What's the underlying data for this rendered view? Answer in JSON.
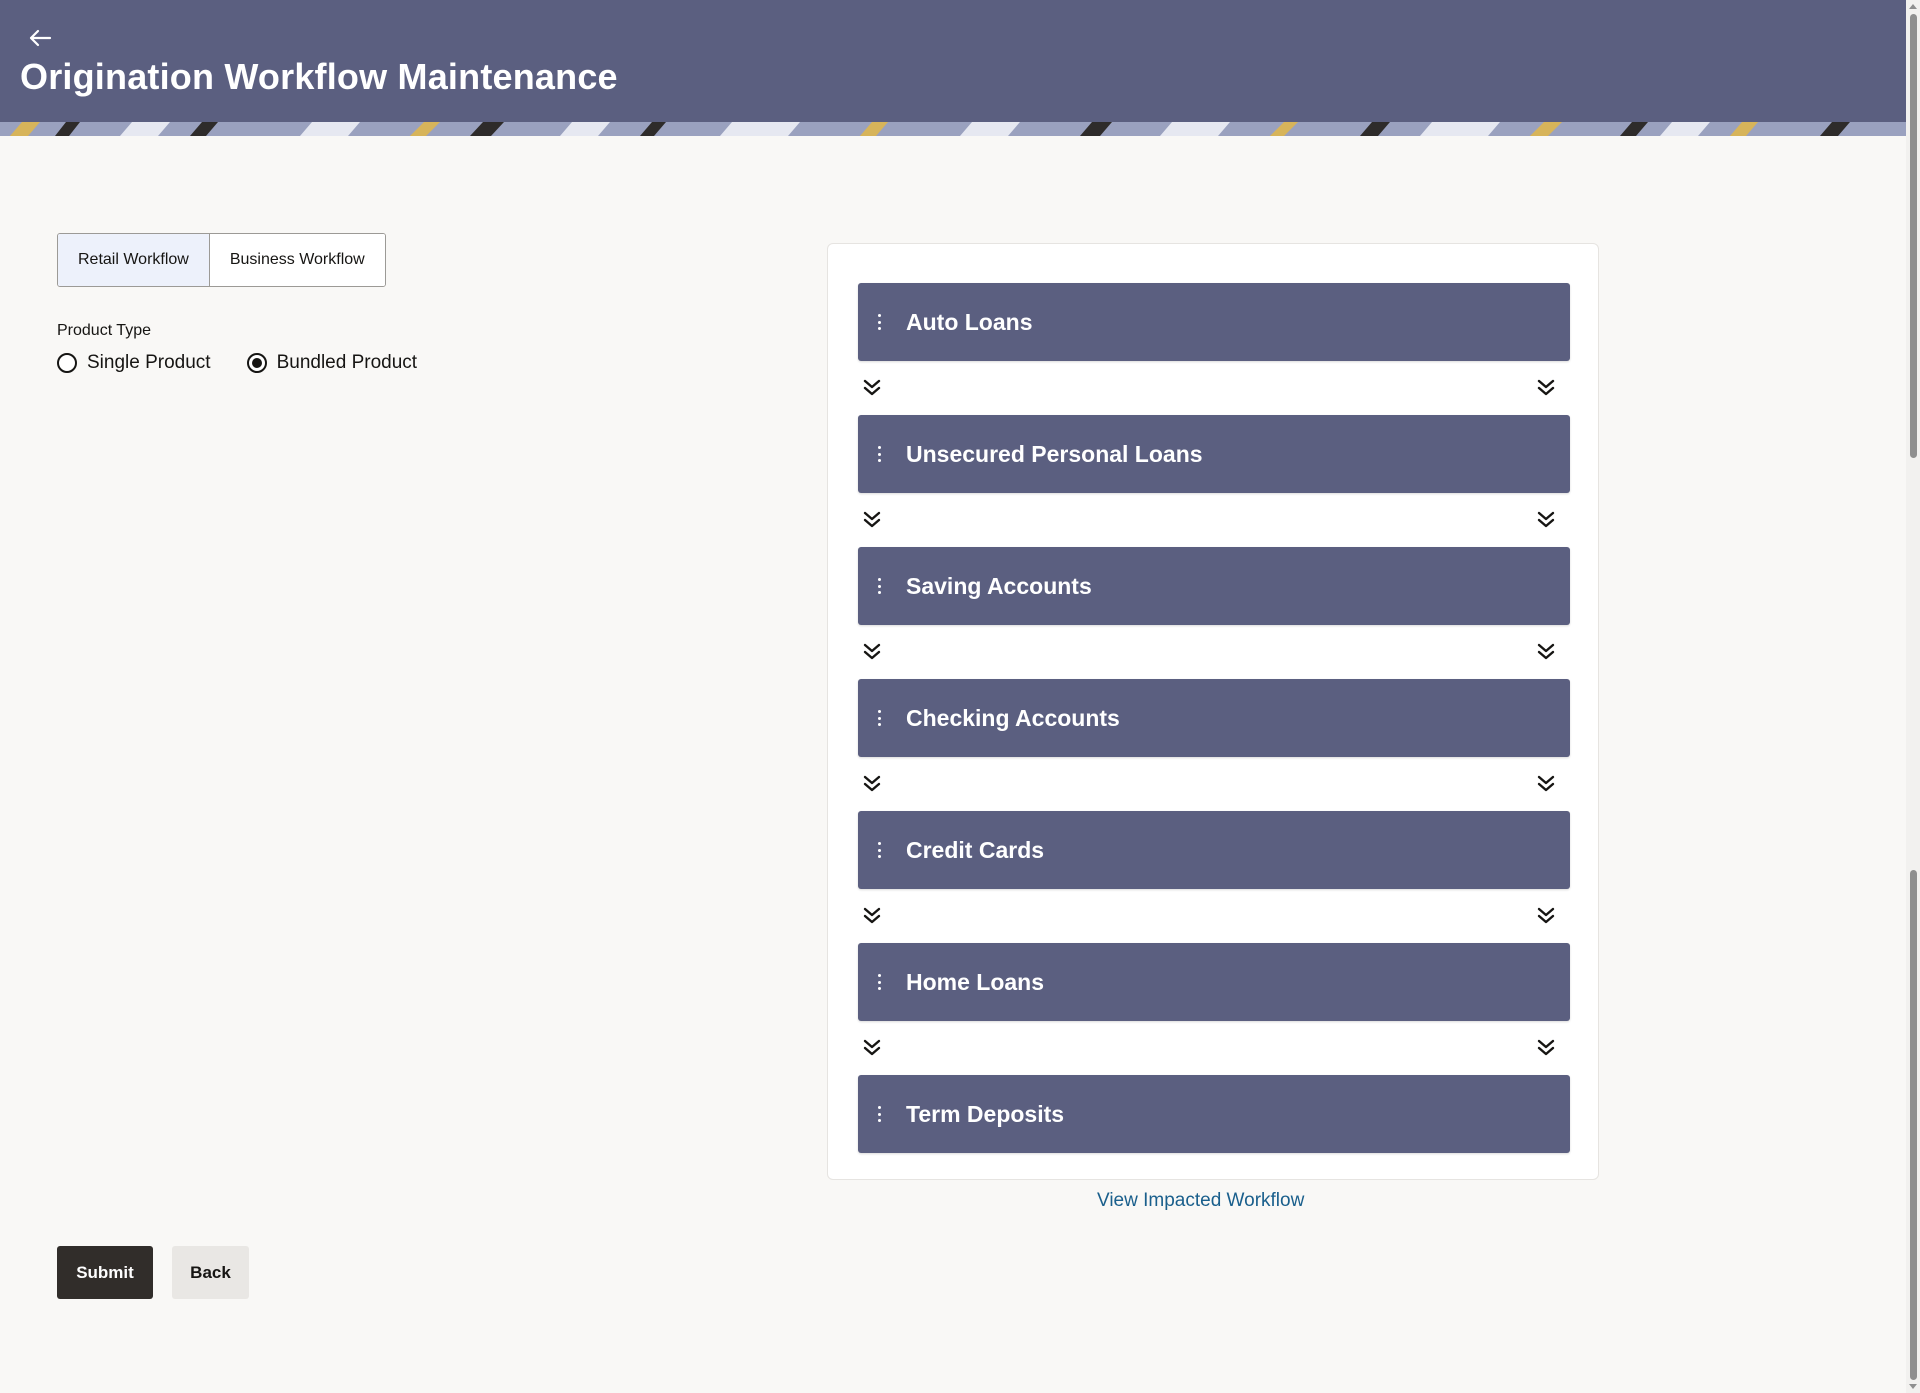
{
  "header": {
    "back_icon": "arrow-left-icon",
    "title": "Origination Workflow Maintenance"
  },
  "workflow_toggle": {
    "selected": "Retail Workflow",
    "options": [
      "Retail Workflow",
      "Business Workflow"
    ]
  },
  "product_type": {
    "label": "Product Type",
    "selected": "Bundled Product",
    "options": [
      "Single Product",
      "Bundled Product"
    ]
  },
  "workflows": {
    "items": [
      "Auto Loans",
      "Unsecured Personal Loans",
      "Saving Accounts",
      "Checking Accounts",
      "Credit Cards",
      "Home Loans",
      "Term Deposits"
    ],
    "drag_icon": "vertical-ellipsis-drag-icon",
    "connector_icon": "double-chevron-down-icon",
    "impact_link": "View Impacted Workflow"
  },
  "actions": {
    "submit_label": "Submit",
    "back_label": "Back"
  },
  "colors": {
    "header_bg": "#5b5f80",
    "card_bg": "#5b5f80",
    "page_bg": "#f9f8f6",
    "submit_bg": "#312d2a",
    "link": "#1a5f8c"
  }
}
